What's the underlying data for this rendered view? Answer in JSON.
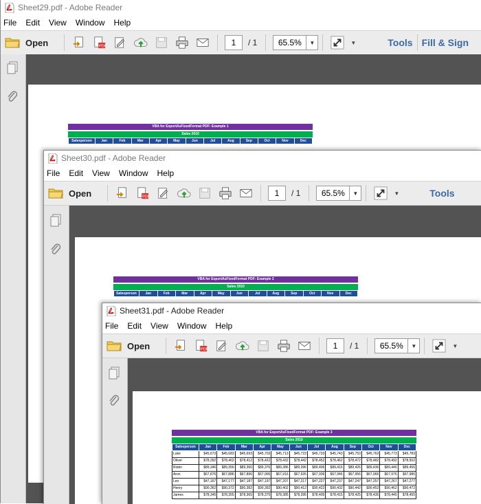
{
  "menu": [
    "File",
    "Edit",
    "View",
    "Window",
    "Help"
  ],
  "toolbar": {
    "open_label": "Open",
    "page_current": "1",
    "page_total": "/ 1",
    "zoom": "65.5%",
    "tools_label": "Tools",
    "fill_sign_label": "Fill & Sign"
  },
  "windows": [
    {
      "title": "Sheet29.pdf - Adobe Reader",
      "sheet_title": "VBA for ExportAsFixedFormat PDF: Example 1"
    },
    {
      "title": "Sheet30.pdf - Adobe Reader",
      "sheet_title": "VBA for ExportAsFixedFormat PDF: Example 2"
    },
    {
      "title": "Sheet31.pdf - Adobe Reader",
      "sheet_title": "VBA for ExportAsFixedFormat PDF: Example 3"
    }
  ],
  "sheet": {
    "sales_label": "Sales 2010",
    "headers": [
      "Salesperson",
      "Jan",
      "Feb",
      "Mar",
      "Apr",
      "May",
      "Jun",
      "Jul",
      "Aug",
      "Sep",
      "Oct",
      "Nov",
      "Dec"
    ],
    "rows": [
      [
        "Luke",
        "$45,673",
        "$45,683",
        "$45,693",
        "$45,703",
        "$45,713",
        "$45,723",
        "$45,733",
        "$45,743",
        "$45,753",
        "$45,763",
        "$45,773",
        "$45,783"
      ],
      [
        "Oliver",
        "$78,392",
        "$78,402",
        "$78,412",
        "$78,422",
        "$78,432",
        "$78,442",
        "$78,452",
        "$78,462",
        "$78,472",
        "$78,482",
        "$78,492",
        "$78,502"
      ],
      [
        "Robin",
        "$89,346",
        "$89,356",
        "$89,366",
        "$89,376",
        "$89,386",
        "$89,396",
        "$89,406",
        "$89,416",
        "$89,426",
        "$89,436",
        "$89,446",
        "$89,456"
      ],
      [
        "Aron",
        "$67,876",
        "$67,886",
        "$67,896",
        "$67,906",
        "$67,916",
        "$67,926",
        "$67,936",
        "$67,946",
        "$67,956",
        "$67,966",
        "$67,976",
        "$67,986"
      ],
      [
        "Leo",
        "$47,167",
        "$47,177",
        "$47,187",
        "$47,197",
        "$47,207",
        "$47,217",
        "$47,227",
        "$47,237",
        "$47,247",
        "$47,257",
        "$47,267",
        "$47,277"
      ],
      [
        "Henry",
        "$90,362",
        "$90,372",
        "$90,382",
        "$90,392",
        "$90,402",
        "$90,412",
        "$90,422",
        "$90,432",
        "$90,442",
        "$90,452",
        "$90,462",
        "$90,472"
      ],
      [
        "James",
        "$78,345",
        "$78,355",
        "$78,365",
        "$78,375",
        "$78,385",
        "$78,395",
        "$78,405",
        "$78,415",
        "$78,425",
        "$78,435",
        "$78,445",
        "$78,455"
      ]
    ]
  },
  "icons": [
    "folder-icon",
    "export-icon",
    "create-pdf-icon",
    "sign-icon",
    "upload-icon",
    "save-icon",
    "print-icon",
    "email-icon",
    "expand-icon",
    "pages-icon",
    "attachment-icon"
  ],
  "colors": {
    "title_bar": "#7030a0",
    "sales_bar": "#00b050",
    "header_bg": "#1f4e9c",
    "tools_text": "#3a6aa8",
    "page_bg": "#535353"
  }
}
